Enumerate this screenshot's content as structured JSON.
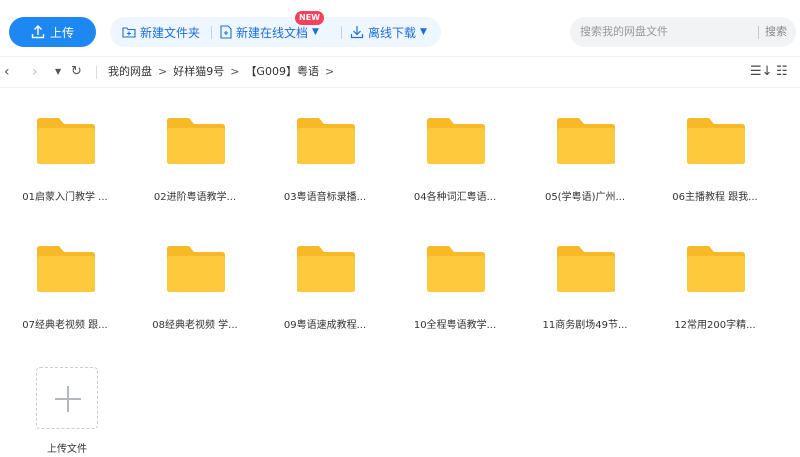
{
  "toolbar": {
    "upload_label": "上传",
    "new_folder_label": "新建文件夹",
    "new_online_doc_label": "新建在线文档",
    "new_badge": "NEW",
    "offline_download_label": "离线下载",
    "search_placeholder": "搜索我的网盘文件",
    "search_button": "搜索",
    "accent_color": "#1e88f2"
  },
  "navbar": {
    "breadcrumbs": [
      "我的网盘",
      "好样猫9号",
      "【G009】粤语"
    ],
    "separator": ">"
  },
  "folders": [
    {
      "name": "01启蒙入门教学 ..."
    },
    {
      "name": "02进阶粤语教学..."
    },
    {
      "name": "03粤语音标录播..."
    },
    {
      "name": "04各种词汇粤语..."
    },
    {
      "name": "05(学粤语)广州..."
    },
    {
      "name": "06主播教程 跟我..."
    },
    {
      "name": "07经典老视频 跟..."
    },
    {
      "name": "08经典老视频 学..."
    },
    {
      "name": "09粤语速成教程..."
    },
    {
      "name": "10全程粤语教学..."
    },
    {
      "name": "11商务剧场49节..."
    },
    {
      "name": "12常用200字精..."
    }
  ],
  "upload_tile": {
    "label": "上传文件"
  },
  "folder_color": "#ffc93e"
}
